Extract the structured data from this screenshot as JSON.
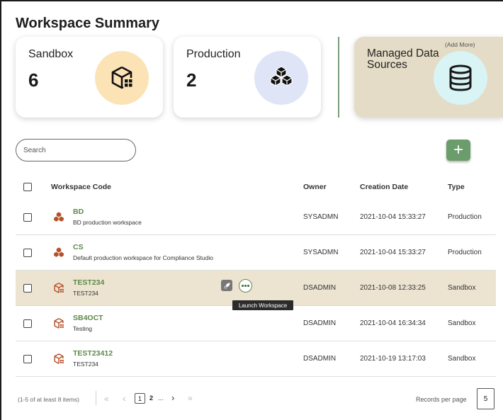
{
  "page": {
    "title": "Workspace Summary"
  },
  "cards": {
    "sandbox": {
      "label": "Sandbox",
      "count": "6",
      "icon": "cube-grid-icon"
    },
    "production": {
      "label": "Production",
      "count": "2",
      "icon": "stacked-cubes-icon"
    },
    "managed": {
      "label": "Managed Data Sources",
      "add_more": "(Add More)",
      "icon": "database-icon"
    }
  },
  "search": {
    "placeholder": "Search",
    "value": ""
  },
  "toolbar": {
    "add_label": "+"
  },
  "table": {
    "headers": {
      "code": "Workspace Code",
      "owner": "Owner",
      "created": "Creation Date",
      "type": "Type"
    },
    "rows": [
      {
        "code": "BD",
        "desc": "BD production workspace",
        "owner": "SYSADMN",
        "created": "2021-10-04 15:33:27",
        "type": "Production",
        "icon": "stacked-cubes-icon"
      },
      {
        "code": "CS",
        "desc": "Default production workspace for Compliance Studio",
        "owner": "SYSADMN",
        "created": "2021-10-04 15:33:27",
        "type": "Production",
        "icon": "stacked-cubes-icon"
      },
      {
        "code": "TEST234",
        "desc": "TEST234",
        "owner": "DSADMIN",
        "created": "2021-10-08 12:33:25",
        "type": "Sandbox",
        "icon": "cube-grid-icon",
        "selected": true
      },
      {
        "code": "SB4OCT",
        "desc": "Testing",
        "owner": "DSADMIN",
        "created": "2021-10-04 16:34:34",
        "type": "Sandbox",
        "icon": "cube-grid-icon"
      },
      {
        "code": "TEST23412",
        "desc": "TEST234",
        "owner": "DSADMIN",
        "created": "2021-10-19 13:17:03",
        "type": "Sandbox",
        "icon": "cube-grid-icon"
      }
    ]
  },
  "tooltip": {
    "text": "Launch Workspace"
  },
  "pagination": {
    "range": "(1-5 of at least 8 items)",
    "first": "«",
    "prev": "‹",
    "page1": "1",
    "page2": "2",
    "ellipsis": "...",
    "next": "›",
    "last": "»",
    "records_label": "Records per page",
    "records_value": "5"
  },
  "colors": {
    "accent_green": "#6b9c6b",
    "code_green": "#5d8a4a",
    "selected_row": "#ece4d1",
    "icon_brown": "#b5502a"
  }
}
